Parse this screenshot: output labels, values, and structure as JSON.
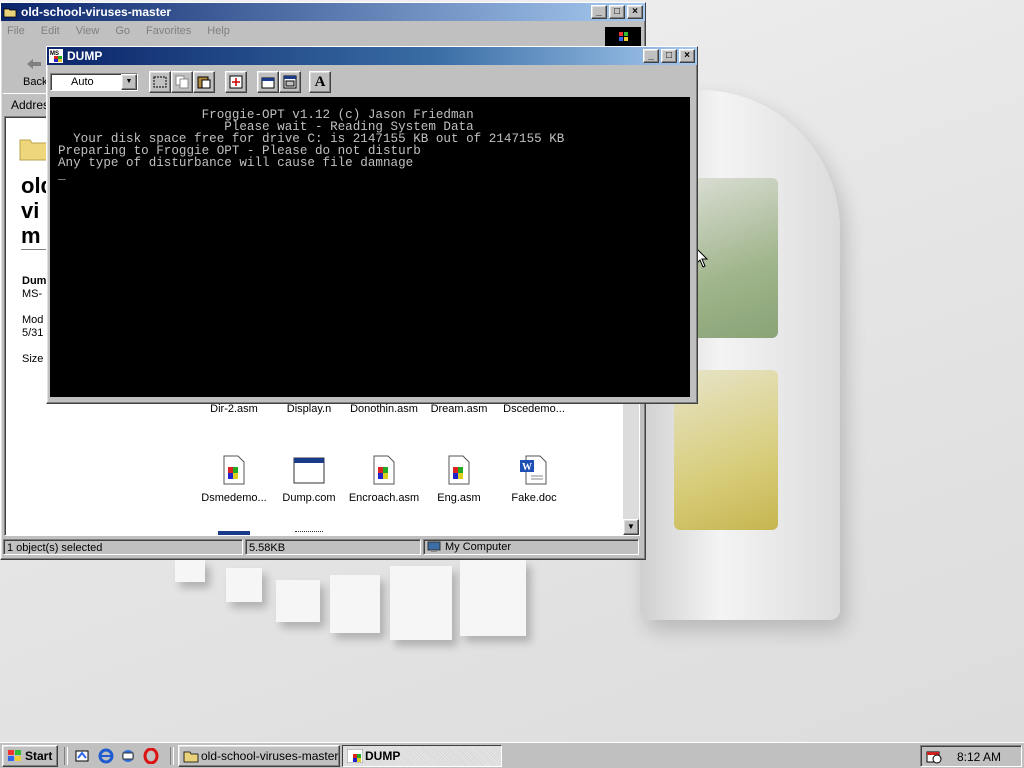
{
  "explorer": {
    "title": "old-school-viruses-master",
    "menu": [
      "File",
      "Edit",
      "View",
      "Go",
      "Favorites",
      "Help"
    ],
    "toolbar_back": "Back",
    "address_label": "Addres",
    "side_title_lines": [
      "old",
      "vi",
      "m"
    ],
    "side_info": [
      "Dum",
      "MS-",
      "Mod",
      "5/31",
      "Size"
    ],
    "files_row1": [
      "Dir-2.asm",
      "Display.n",
      "Donothin.asm",
      "Dream.asm",
      "Dscedemo..."
    ],
    "files_row2": [
      {
        "name": "Dsmedemo...",
        "icon": "asm-file-icon"
      },
      {
        "name": "Dump.com",
        "icon": "com-program-icon"
      },
      {
        "name": "Encroach.asm",
        "icon": "asm-file-icon"
      },
      {
        "name": "Eng.asm",
        "icon": "asm-file-icon"
      },
      {
        "name": "Fake.doc",
        "icon": "word-document-icon"
      }
    ],
    "status": {
      "selection": "1 object(s) selected",
      "size": "5.58KB",
      "zone": "My Computer"
    }
  },
  "dump": {
    "title": "DUMP",
    "font_size_select": "Auto",
    "console_lines": [
      "                   Froggie-OPT v1.12 (c) Jason Friedman",
      "                      Please wait - Reading System Data",
      "  Your disk space free for drive C: is 2147155 KB out of 2147155 KB",
      "Preparing to Froggie OPT - Please do not disturb",
      "Any type of disturbance will cause file damnage",
      "_"
    ]
  },
  "taskbar": {
    "start_label": "Start",
    "tasks": [
      "old-school-viruses-master",
      "DUMP"
    ],
    "clock": "8:12 AM"
  },
  "colors": {
    "title_active": "#0a246a",
    "title_gradient_end": "#a6caf0",
    "face": "#c0c0c0",
    "console_bg": "#000000",
    "console_fg": "#c0c0c0"
  }
}
